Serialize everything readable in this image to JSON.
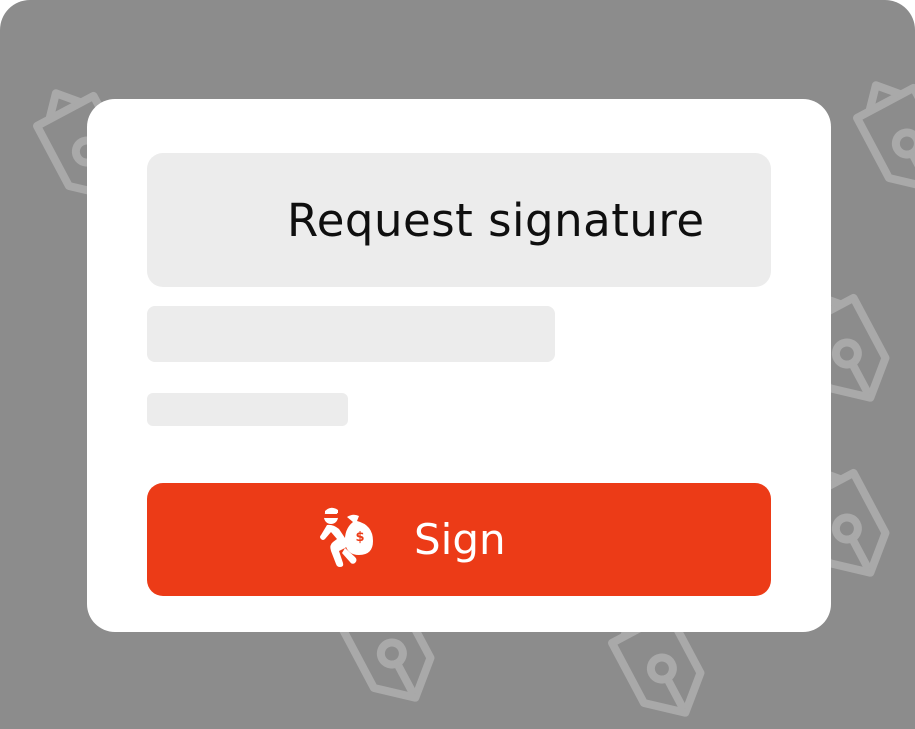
{
  "dialog": {
    "title": "Request signature",
    "sign_button_label": "Sign"
  },
  "icons": {
    "button_icon": "money-bag-thief-icon",
    "background_icon": "fountain-pen-nib-icon"
  },
  "colors": {
    "frame_background": "#8c8c8c",
    "card_background": "#ffffff",
    "placeholder": "#ececec",
    "accent": "#ec3b17",
    "pattern_stroke": "#a9a9a9"
  }
}
